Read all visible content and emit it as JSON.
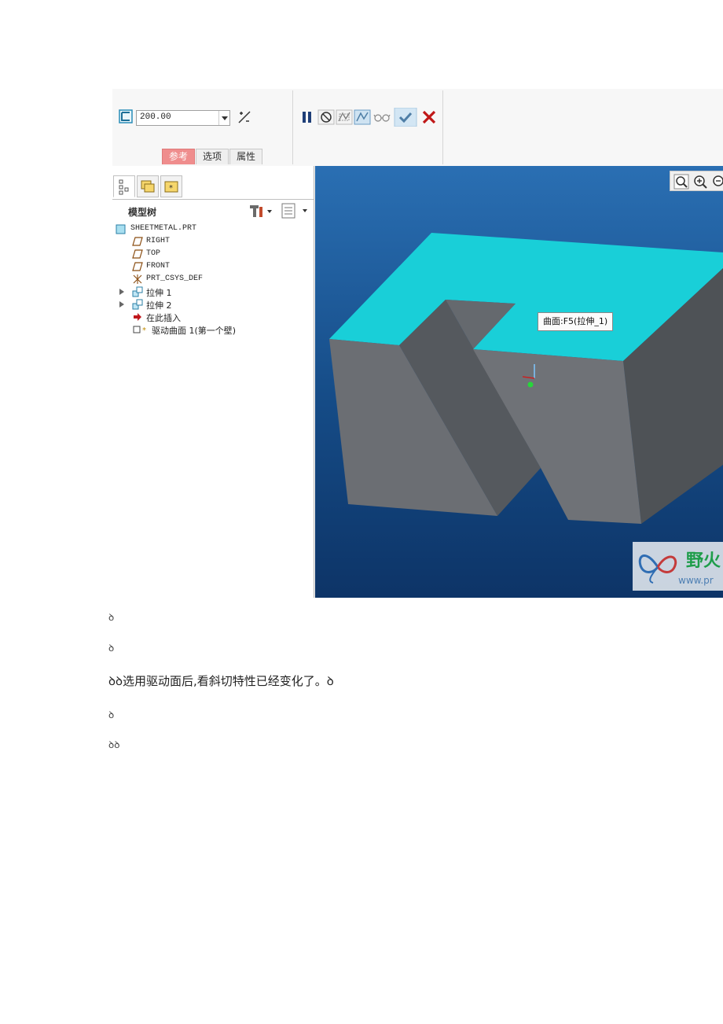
{
  "ribbon": {
    "depth_value": "200.00",
    "tabs": [
      {
        "label": "参考",
        "active": true
      },
      {
        "label": "选项",
        "active": false
      },
      {
        "label": "属性",
        "active": false
      }
    ],
    "toolbar_icons": [
      "pause-icon",
      "no-preview-icon",
      "geometry-preview-icon",
      "feature-preview-icon",
      "glasses-icon",
      "confirm-check-icon",
      "cancel-x-icon"
    ]
  },
  "model_tree": {
    "title": "模型树",
    "items": [
      {
        "label": "SHEETMETAL.PRT",
        "icon": "part-icon",
        "expandable": false,
        "indent": 0
      },
      {
        "label": "RIGHT",
        "icon": "datum-plane-icon",
        "expandable": false,
        "indent": 1
      },
      {
        "label": "TOP",
        "icon": "datum-plane-icon",
        "expandable": false,
        "indent": 1
      },
      {
        "label": "FRONT",
        "icon": "datum-plane-icon",
        "expandable": false,
        "indent": 1
      },
      {
        "label": "PRT_CSYS_DEF",
        "icon": "csys-icon",
        "expandable": false,
        "indent": 1
      },
      {
        "label": "拉伸 1",
        "icon": "extrude-icon",
        "expandable": true,
        "indent": 1
      },
      {
        "label": "拉伸 2",
        "icon": "extrude-icon",
        "expandable": true,
        "indent": 1
      },
      {
        "label": "在此插入",
        "icon": "insert-here-arrow-icon",
        "expandable": false,
        "indent": 1
      },
      {
        "label": "驱动曲面 1(第一个壁)",
        "icon": "driving-surface-icon",
        "expandable": false,
        "indent": 1
      }
    ]
  },
  "viewport": {
    "tooltip": "曲面:F5(拉伸_1)",
    "watermark_text": "野火",
    "watermark_url": "www.pr"
  },
  "document": {
    "marker": "ꝺ",
    "paragraphs": [
      "ꝺ",
      "ꝺ",
      "ꝺꝺ选用驱动面后,看斜切特性已经变化了。ꝺ",
      "ꝺ",
      "ꝺꝺ"
    ]
  },
  "colors": {
    "top_face": "#19cfd8",
    "side_face": "#6b6e73",
    "viewport_bg": "#1a5593",
    "active_tab": "#ef8d8d"
  }
}
